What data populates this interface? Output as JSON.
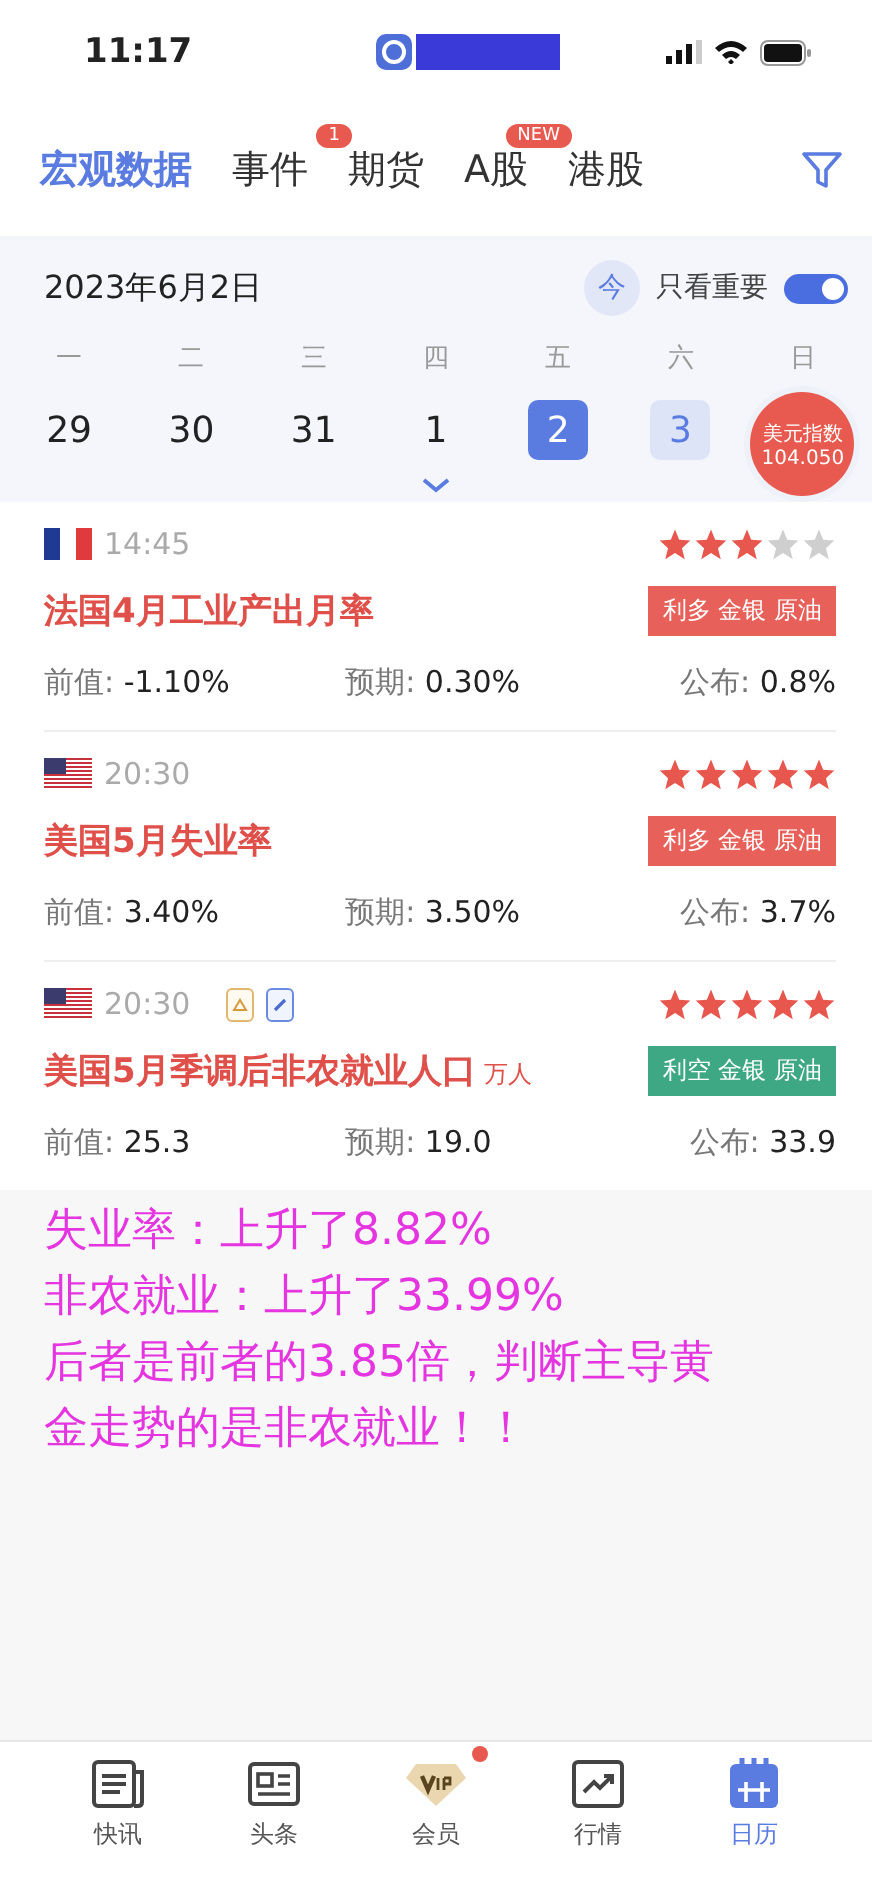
{
  "status_bar": {
    "time": "11:17"
  },
  "tabs": [
    {
      "label": "宏观数据",
      "selected": true
    },
    {
      "label": "事件",
      "selected": false,
      "badge": "1"
    },
    {
      "label": "期货",
      "selected": false
    },
    {
      "label": "A股",
      "selected": false,
      "badge": "NEW"
    },
    {
      "label": "港股",
      "selected": false
    }
  ],
  "calendar": {
    "date": "2023年6月2日",
    "today_button": "今",
    "important_toggle": {
      "label": "只看重要",
      "on": true
    },
    "weekdays": [
      "一",
      "二",
      "三",
      "四",
      "五",
      "六",
      "日"
    ],
    "days": [
      {
        "label": "29",
        "selected": false,
        "highlighted": false
      },
      {
        "label": "30",
        "selected": false,
        "highlighted": false
      },
      {
        "label": "31",
        "selected": false,
        "highlighted": false
      },
      {
        "label": "1",
        "selected": false,
        "highlighted": false
      },
      {
        "label": "2",
        "selected": true,
        "highlighted": false
      },
      {
        "label": "3",
        "selected": false,
        "highlighted": true
      }
    ],
    "index_badge": {
      "label": "美元指数",
      "value": "104.050"
    }
  },
  "events": [
    {
      "kind": "fr",
      "time": "14:45",
      "stars": 3,
      "title": "法国4月工业产出月率",
      "tag": {
        "text": "利多 金银 原油",
        "color": "#e8605a"
      },
      "previous": {
        "label": "前值:",
        "value": "-1.10%"
      },
      "forecast": {
        "label": "预期:",
        "value": "0.30%"
      },
      "actual": {
        "label": "公布:",
        "value": "0.8%"
      }
    },
    {
      "kind": "us",
      "time": "20:30",
      "stars": 5,
      "title": "美国5月失业率",
      "tag": {
        "text": "利多 金银 原油",
        "color": "#e8605a"
      },
      "previous": {
        "label": "前值:",
        "value": "3.40%"
      },
      "forecast": {
        "label": "预期:",
        "value": "3.50%"
      },
      "actual": {
        "label": "公布:",
        "value": "3.7%"
      }
    },
    {
      "kind": "us",
      "time": "20:30",
      "attachments": [
        {
          "kind": "pdf"
        },
        {
          "kind": "link"
        }
      ],
      "stars": 5,
      "title": "美国5月季调后非农就业人口",
      "unit": "万人",
      "tag": {
        "text": "利空 金银 原油",
        "color": "#3ea884"
      },
      "previous": {
        "label": "前值:",
        "value": "25.3"
      },
      "forecast": {
        "label": "预期:",
        "value": "19.0"
      },
      "actual": {
        "label": "公布:",
        "value": "33.9"
      }
    }
  ],
  "annotation": [
    "失业率：上升了8.82%",
    "非农就业：上升了33.99%",
    "后者是前者的3.85倍，判断主导黄金走势的是非农就业！！"
  ],
  "bottom_nav": [
    {
      "kind": "news",
      "label": "快讯",
      "selected": false
    },
    {
      "kind": "headline",
      "label": "头条",
      "selected": false
    },
    {
      "kind": "vip",
      "label": "会员",
      "selected": false,
      "dot": true
    },
    {
      "kind": "market",
      "label": "行情",
      "selected": false
    },
    {
      "kind": "calendar",
      "label": "日历",
      "selected": true
    }
  ]
}
